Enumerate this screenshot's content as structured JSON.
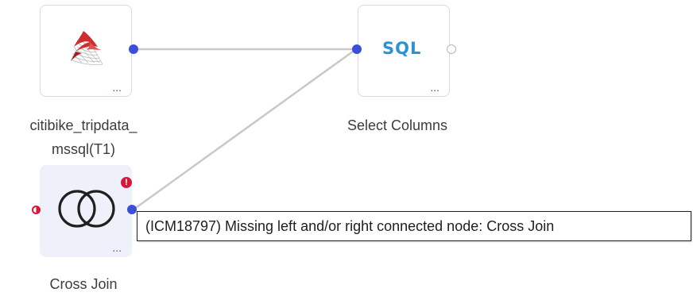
{
  "colors": {
    "port_connected": "#3b4fd8",
    "port_open": "#b8b8b8",
    "error": "#d6163b",
    "sql_text": "#2a93d5",
    "edge": "#c8c8c8",
    "selected_node_bg": "#eef0fa"
  },
  "nodes": {
    "source": {
      "icon": "sql-server-icon",
      "more_label": "...",
      "label_line1": "citibike_tripdata_",
      "label_line2": "mssql(T1)"
    },
    "select_columns": {
      "icon_text": "SQL",
      "more_label": "...",
      "label": "Select Columns"
    },
    "cross_join": {
      "icon": "cross-join-icon",
      "more_label": "...",
      "error_mark": "!",
      "label": "Cross Join"
    }
  },
  "tooltip": {
    "text": "(ICM18797) Missing left and/or right connected node: Cross Join"
  }
}
